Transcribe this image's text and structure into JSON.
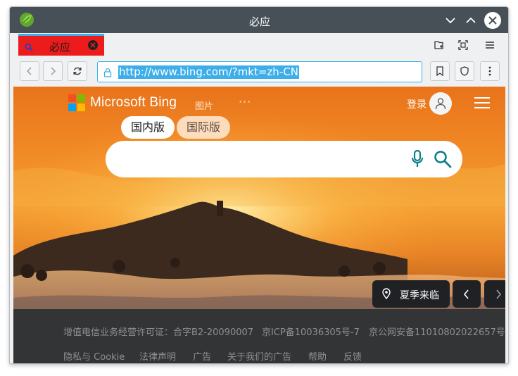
{
  "window": {
    "title": "必应"
  },
  "tab": {
    "label": "必应"
  },
  "navbar": {
    "url": "http://www.bing.com/?mkt=zh-CN"
  },
  "bing": {
    "logo_text": "Microsoft Bing",
    "nav_images": "图片",
    "nav_more": "···",
    "login": "登录",
    "scope_domestic": "国内版",
    "scope_international": "国际版",
    "location_label": "夏季来临"
  },
  "footer": {
    "license": "增值电信业务经营许可证：合字B2-20090007",
    "icp": "京ICP备10036305号-7",
    "police": "京公网安备11010802022657号",
    "privacy": "隐私与 Cookie",
    "legal": "法律声明",
    "ads": "广告",
    "about_ads": "关于我们的广告",
    "help": "帮助",
    "feedback": "反馈"
  },
  "colors": {
    "titlebar": "#475057",
    "tab_active": "#ed1c1c",
    "accent": "#3daee9",
    "footer_bg": "#333436",
    "bing_teal": "#0d7f8a"
  }
}
